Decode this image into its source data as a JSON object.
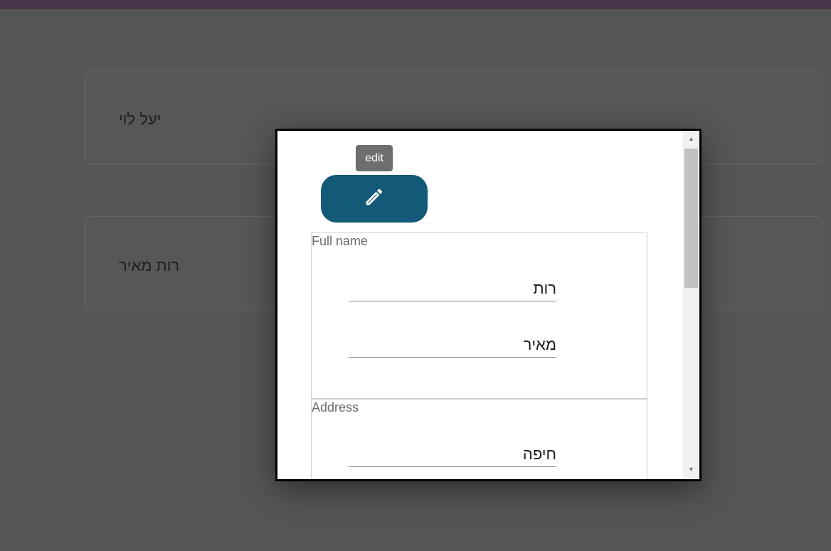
{
  "cards": [
    {
      "name": "יעל לוי"
    },
    {
      "name": "רות מאיר"
    }
  ],
  "dialog": {
    "tooltip": "edit",
    "edit_icon": "pencil-icon",
    "full_name": {
      "legend": "Full name",
      "first_name": "רות",
      "last_name": "מאיר"
    },
    "address": {
      "legend": "Address",
      "city": "חיפה"
    }
  },
  "colors": {
    "top_bar": "#4a3449",
    "overlay": "#555555",
    "edit_button": "#135a78"
  }
}
